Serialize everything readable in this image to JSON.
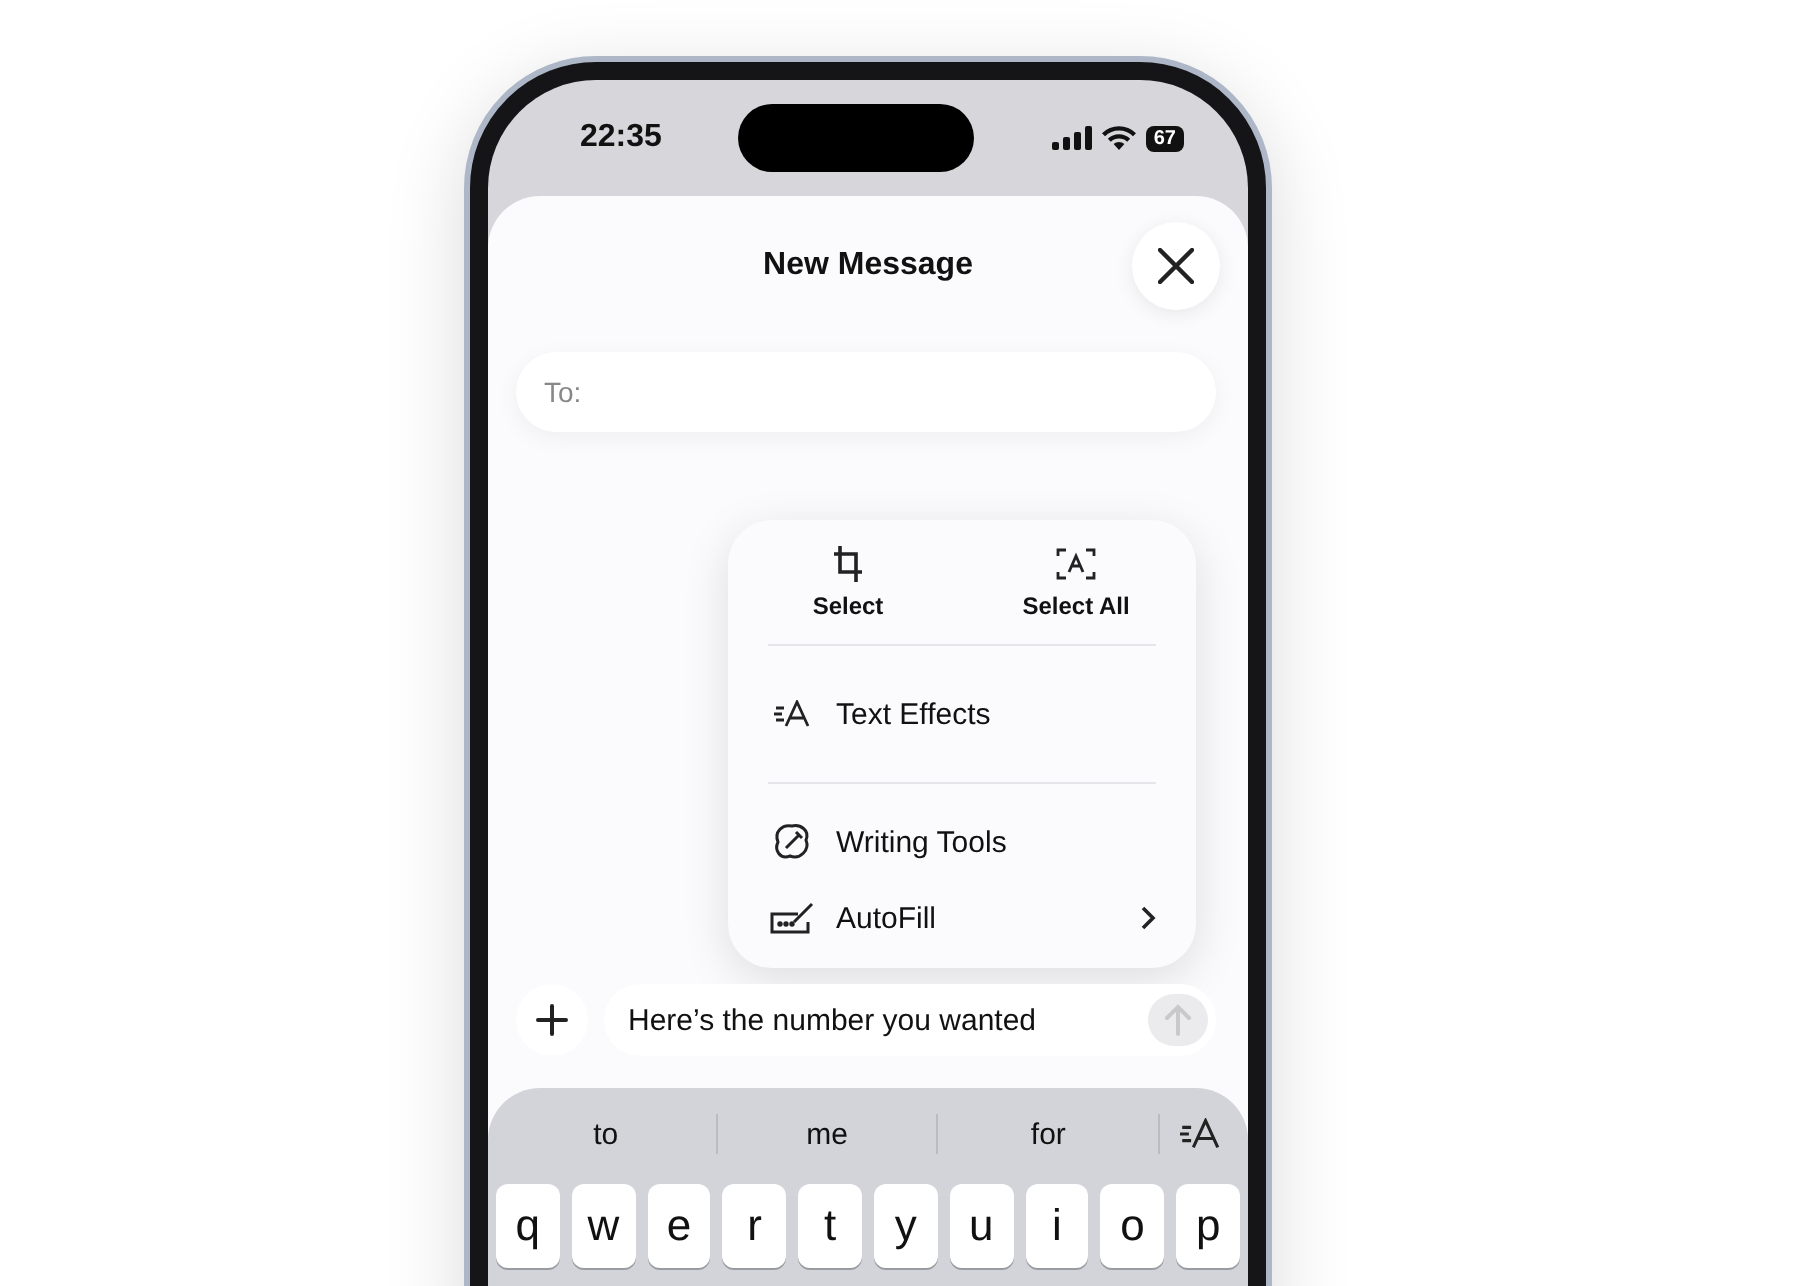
{
  "status_bar": {
    "time": "22:35",
    "battery": "67"
  },
  "sheet": {
    "title": "New Message"
  },
  "to_field": {
    "label": "To:"
  },
  "context_menu": {
    "top_actions": [
      {
        "kind": "select",
        "label": "Select"
      },
      {
        "kind": "select_all",
        "label": "Select All"
      }
    ],
    "items": [
      {
        "kind": "text_effects",
        "label": "Text Effects",
        "has_submenu": false,
        "divider_after": true
      },
      {
        "kind": "writing_tools",
        "label": "Writing Tools",
        "has_submenu": false,
        "divider_after": false
      },
      {
        "kind": "autofill",
        "label": "AutoFill",
        "has_submenu": true,
        "divider_after": false
      }
    ]
  },
  "compose": {
    "text": "Here’s the number you wanted",
    "send_enabled": false
  },
  "keyboard": {
    "suggestions": [
      "to",
      "me",
      "for"
    ],
    "keys": [
      "q",
      "w",
      "e",
      "r",
      "t",
      "y",
      "u",
      "i",
      "o",
      "p"
    ]
  }
}
